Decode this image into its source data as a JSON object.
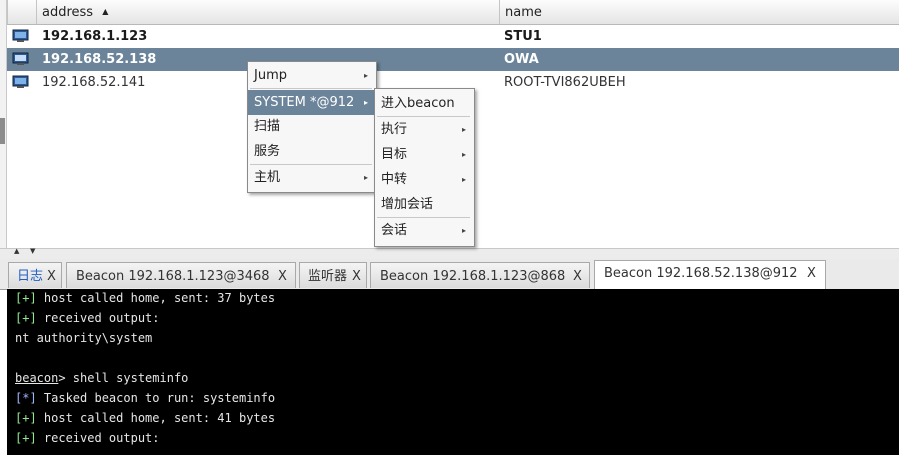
{
  "table": {
    "columns": [
      "address",
      "name"
    ],
    "sort_indicator": "▲",
    "rows": [
      {
        "address": "192.168.1.123",
        "name": "STU1",
        "style": "bold"
      },
      {
        "address": "192.168.52.138",
        "name": "OWA",
        "style": "selected"
      },
      {
        "address": "192.168.52.141",
        "name": "ROOT-TVI862UBEH",
        "style": "normal"
      }
    ]
  },
  "splitter": {
    "up": "▲",
    "down": "▼"
  },
  "context_menu": {
    "items": [
      {
        "label": "Jump",
        "arrow": "▸"
      },
      {
        "label": "SYSTEM *@912",
        "arrow": "▸"
      },
      {
        "label": "扫描"
      },
      {
        "label": "服务"
      },
      {
        "label": "主机",
        "arrow": "▸"
      }
    ]
  },
  "submenu": {
    "items": [
      {
        "label": "进入beacon"
      },
      {
        "label": "执行",
        "arrow": "▸"
      },
      {
        "label": "目标",
        "arrow": "▸"
      },
      {
        "label": "中转",
        "arrow": "▸"
      },
      {
        "label": "增加会话"
      },
      {
        "label": "会话",
        "arrow": "▸"
      }
    ]
  },
  "tabs": [
    {
      "label": "日志",
      "close": "X"
    },
    {
      "label": "Beacon 192.168.1.123@3468",
      "close": "X"
    },
    {
      "label": "监听器",
      "close": "X"
    },
    {
      "label": "Beacon 192.168.1.123@868",
      "close": "X"
    },
    {
      "label": "Beacon 192.168.52.138@912",
      "close": "X"
    }
  ],
  "console": {
    "lines": [
      {
        "tag": "[+]",
        "text": " host called home, sent: 37 bytes"
      },
      {
        "tag": "[+]",
        "text": " received output:"
      },
      {
        "text": "nt authority\\system"
      },
      {
        "text": ""
      },
      {
        "prompt": "beacon",
        "text": "> shell systeminfo"
      },
      {
        "tag": "[*]",
        "text": " Tasked beacon to run: systeminfo"
      },
      {
        "tag": "[+]",
        "text": " host called home, sent: 41 bytes"
      },
      {
        "tag": "[+]",
        "text": " received output:"
      }
    ]
  },
  "colors": {
    "selection": "#6b849a",
    "console_bg": "#000000",
    "tag_green": "#8fe88f",
    "tag_blue": "#9fb6ff"
  }
}
